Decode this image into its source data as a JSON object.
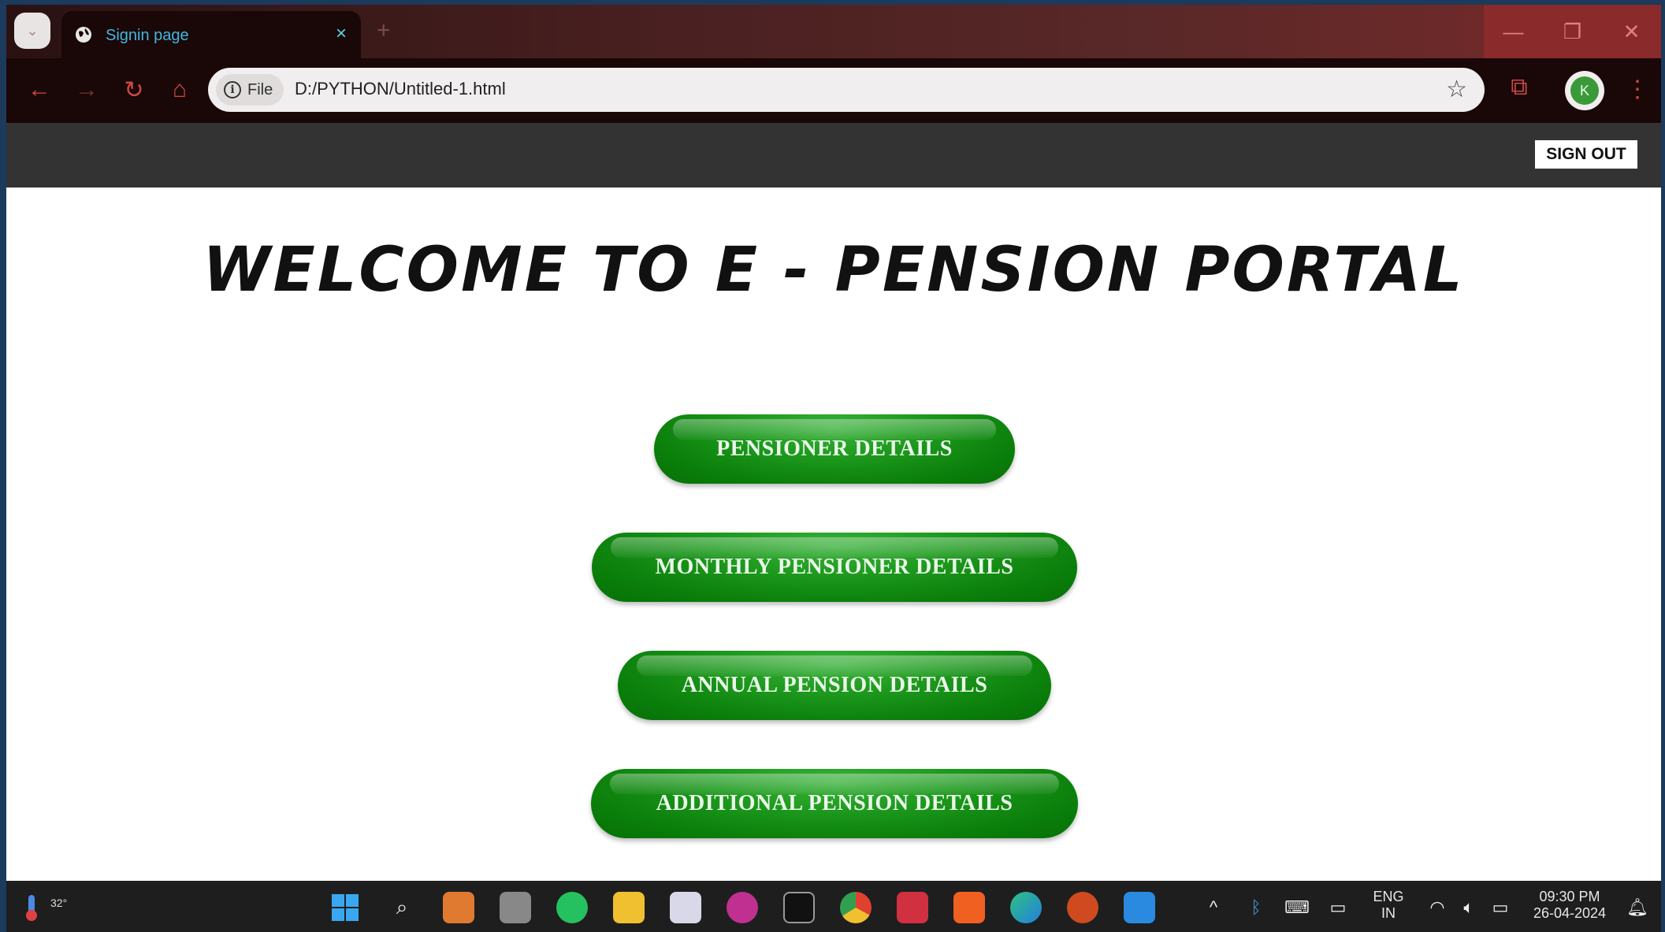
{
  "browser": {
    "tab_title": "Signin page",
    "tab_close": "×",
    "new_tab": "+",
    "address_chip": "File",
    "url": "D:/PYTHON/Untitled-1.html",
    "profile_initial": "K"
  },
  "header": {
    "sign_out_label": "SIGN OUT"
  },
  "main": {
    "title": "WELCOME TO E - PENSION PORTAL",
    "buttons": [
      "PENSIONER DETAILS",
      "MONTHLY PENSIONER DETAILS",
      "ANNUAL PENSION DETAILS",
      "ADDITIONAL PENSION DETAILS"
    ]
  },
  "taskbar": {
    "temperature": "32°",
    "language_top": "ENG",
    "language_bottom": "IN",
    "time": "09:30 PM",
    "date": "26-04-2024"
  },
  "colors": {
    "button_green": "#0a8a0a",
    "header_bar": "#333333",
    "tab_accent": "#3fb8e0"
  }
}
